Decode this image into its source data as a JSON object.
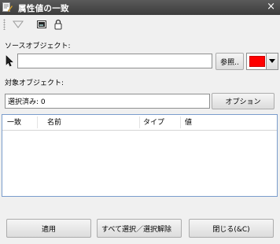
{
  "window": {
    "title": "属性値の一致",
    "close_glyph": "×"
  },
  "toolbar": {
    "icons": [
      "toolbar-grip-icon",
      "filter-icon",
      "image-icon",
      "lock-icon"
    ]
  },
  "source": {
    "label": "ソースオブジェクト:",
    "value": "",
    "browse_label": "参照..",
    "color": "#ff0000"
  },
  "target": {
    "label": "対象オブジェクト:",
    "selected_text": "選択済み: 0",
    "options_label": "オプション"
  },
  "table": {
    "columns": [
      "一致",
      "名前",
      "タイプ",
      "値"
    ],
    "rows": []
  },
  "footer": {
    "apply_label": "適用",
    "toggle_select_label": "すべて選択／選択解除",
    "close_label": "閉じる(&C)"
  }
}
